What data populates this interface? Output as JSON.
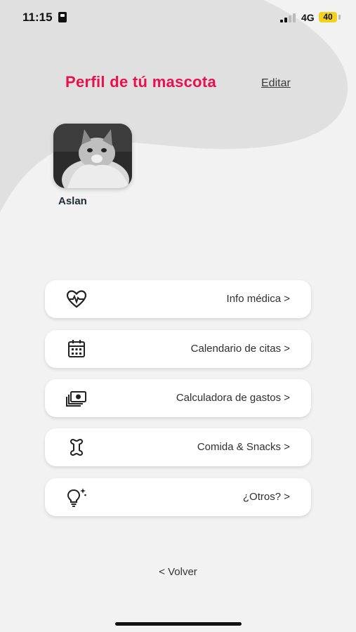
{
  "status_bar": {
    "time": "11:15",
    "network": "4G",
    "battery": "40"
  },
  "header": {
    "title": "Perfil de tú mascota",
    "edit_label": "Editar"
  },
  "pet": {
    "name": "Aslan",
    "photo_icon": "cat-photo"
  },
  "menu": [
    {
      "label": "Info médica >",
      "icon": "heart-pulse-icon"
    },
    {
      "label": "Calendario de citas >",
      "icon": "calendar-icon"
    },
    {
      "label": "Calculadora de gastos >",
      "icon": "money-icon"
    },
    {
      "label": "Comida & Snacks >",
      "icon": "bone-icon"
    },
    {
      "label": "¿Otros? >",
      "icon": "lightbulb-icon"
    }
  ],
  "footer": {
    "back_label": "< Volver"
  },
  "colors": {
    "accent": "#e8114d",
    "background": "#f1f2f1",
    "blob": "#dfe0df",
    "battery": "#f2d21e"
  }
}
